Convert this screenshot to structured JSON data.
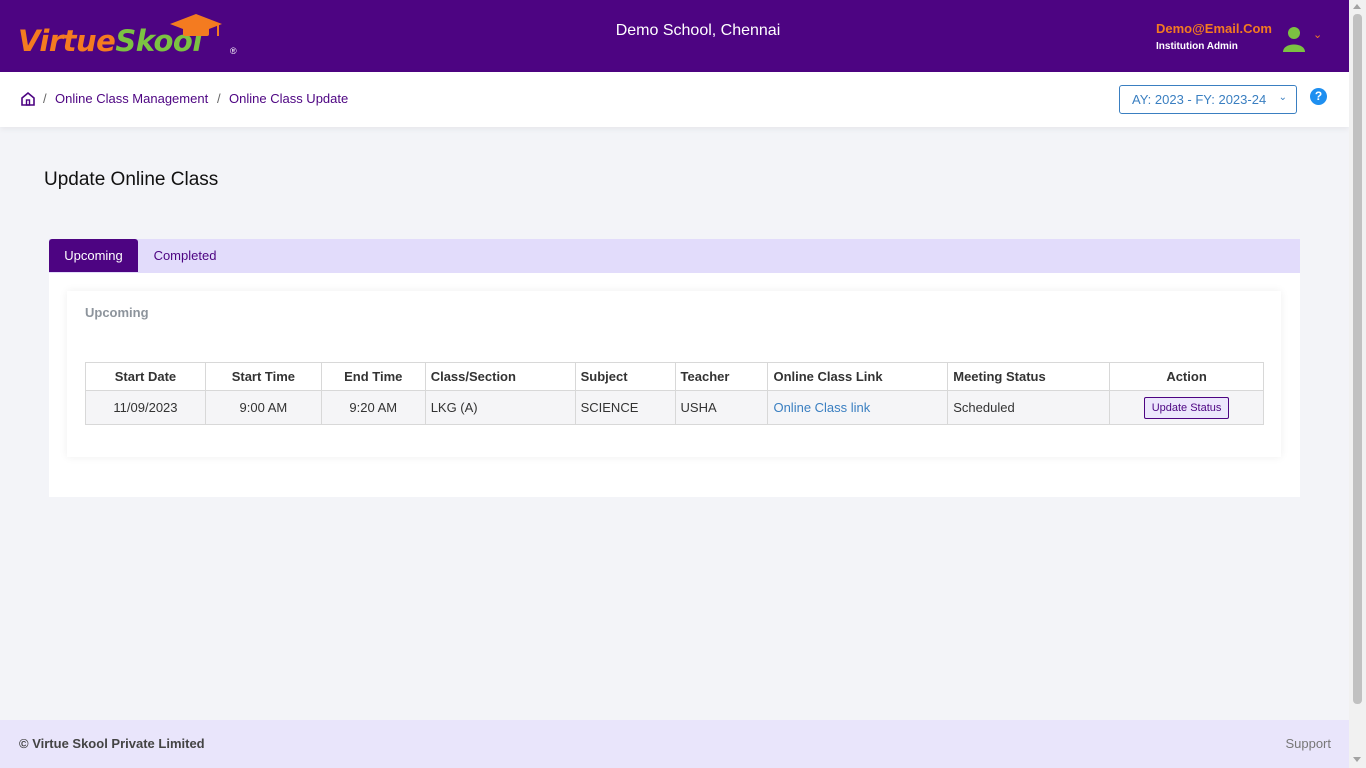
{
  "header": {
    "logo_part1": "Virtue",
    "logo_part2": "Skool",
    "logo_reg": "®",
    "school_name": "Demo School, Chennai",
    "user_email": "Demo@Email.Com",
    "user_role": "Institution Admin"
  },
  "breadcrumb": {
    "items": [
      "Online Class Management",
      "Online Class Update"
    ],
    "separator": "/"
  },
  "academic_year": "AY: 2023 - FY: 2023-24",
  "help": "?",
  "page_title": "Update Online Class",
  "tabs": [
    {
      "label": "Upcoming",
      "active": true
    },
    {
      "label": "Completed",
      "active": false
    }
  ],
  "section_title": "Upcoming",
  "table": {
    "columns": [
      "Start Date",
      "Start Time",
      "End Time",
      "Class/Section",
      "Subject",
      "Teacher",
      "Online Class Link",
      "Meeting Status",
      "Action"
    ],
    "rows": [
      {
        "start_date": "11/09/2023",
        "start_time": "9:00 AM",
        "end_time": "9:20 AM",
        "class_section": "LKG (A)",
        "subject": "SCIENCE",
        "teacher": "USHA",
        "link": "Online Class link",
        "status": "Scheduled",
        "action": "Update Status"
      }
    ]
  },
  "footer": {
    "copyright": "© Virtue Skool Private Limited",
    "support": "Support"
  },
  "colors": {
    "brand_purple": "#4d0482",
    "orange": "#f47b20",
    "green": "#7cc242",
    "link_blue": "#3a7fc1"
  }
}
